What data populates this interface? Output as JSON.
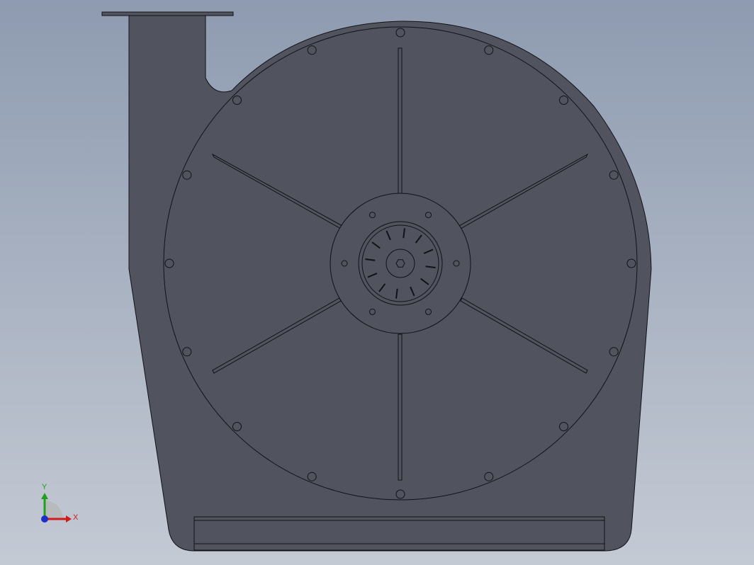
{
  "viewport": {
    "background_top": "#8e9bb0",
    "background_bottom": "#c4cad4",
    "part_fill": "#51535f",
    "edge_color": "#111216"
  },
  "triad": {
    "x_label": "X",
    "y_label": "Y",
    "x_color": "#d11a1a",
    "y_color": "#1fa01f",
    "z_color": "#1c2fc8"
  }
}
